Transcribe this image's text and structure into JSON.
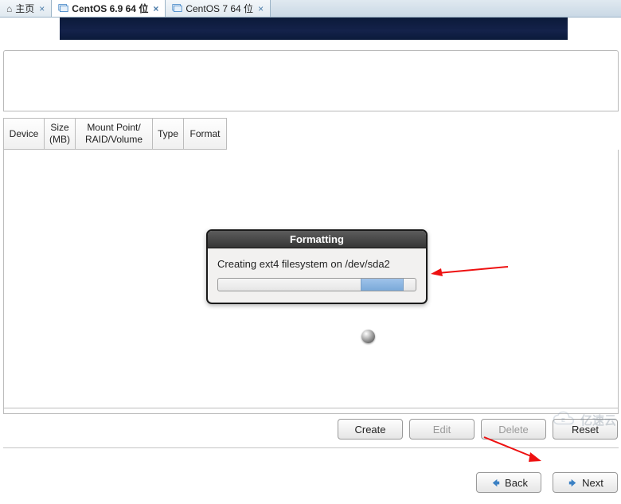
{
  "tabs": [
    {
      "label": "主页",
      "icon": "home"
    },
    {
      "label": "CentOS 6.9 64 位",
      "icon": "vm",
      "active": true
    },
    {
      "label": "CentOS 7 64 位",
      "icon": "vm"
    }
  ],
  "table_headers": {
    "device": "Device",
    "size": "Size\n(MB)",
    "mount": "Mount Point/\nRAID/Volume",
    "type": "Type",
    "format": "Format"
  },
  "dialog": {
    "title": "Formatting",
    "message": "Creating ext4 filesystem on /dev/sda2"
  },
  "buttons": {
    "create": "Create",
    "edit": "Edit",
    "delete": "Delete",
    "reset": "Reset",
    "back": "Back",
    "next": "Next"
  },
  "watermark": "亿速云"
}
